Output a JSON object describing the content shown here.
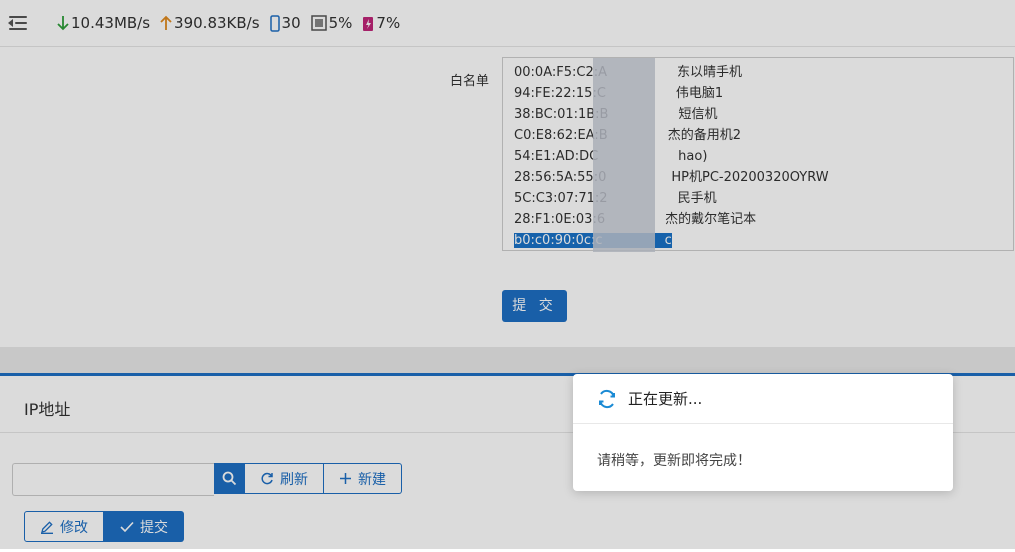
{
  "topbar": {
    "download_speed": "10.43MB/s",
    "upload_speed": "390.83KB/s",
    "connections": "30",
    "cpu": "5%",
    "memory": "7%"
  },
  "whitelist": {
    "label": "白名单",
    "lines": [
      "00:0A:F5:C2:A",
      "94:FE:22:15:C",
      "38:BC:01:1B:B",
      "C0:E8:62:EA:B",
      "54:E1:AD:DC",
      "28:56:5A:55:0",
      "5C:C3:07:71:2",
      "28:F1:0E:03:6",
      "b0:c0:90:0c:c"
    ],
    "line_suffixes": [
      "东以晴手机",
      "伟电脑1",
      "短信机",
      "杰的备用机2",
      "hao)",
      "HP机PC-20200320OYRW",
      "民手机",
      "杰的戴尔笔记本",
      "c"
    ],
    "submit_label": "提 交"
  },
  "ip_section": {
    "title": "IP地址",
    "search_placeholder": "",
    "refresh_label": "刷新",
    "new_label": "新建",
    "modify_label": "修改",
    "submit_label": "提交"
  },
  "dialog": {
    "title": "正在更新...",
    "message": "请稍等，更新即将完成！"
  },
  "colors": {
    "primary": "#1e6fc4",
    "download": "#2e9e3a",
    "upload": "#e08a1e",
    "memory": "#c0267a"
  }
}
